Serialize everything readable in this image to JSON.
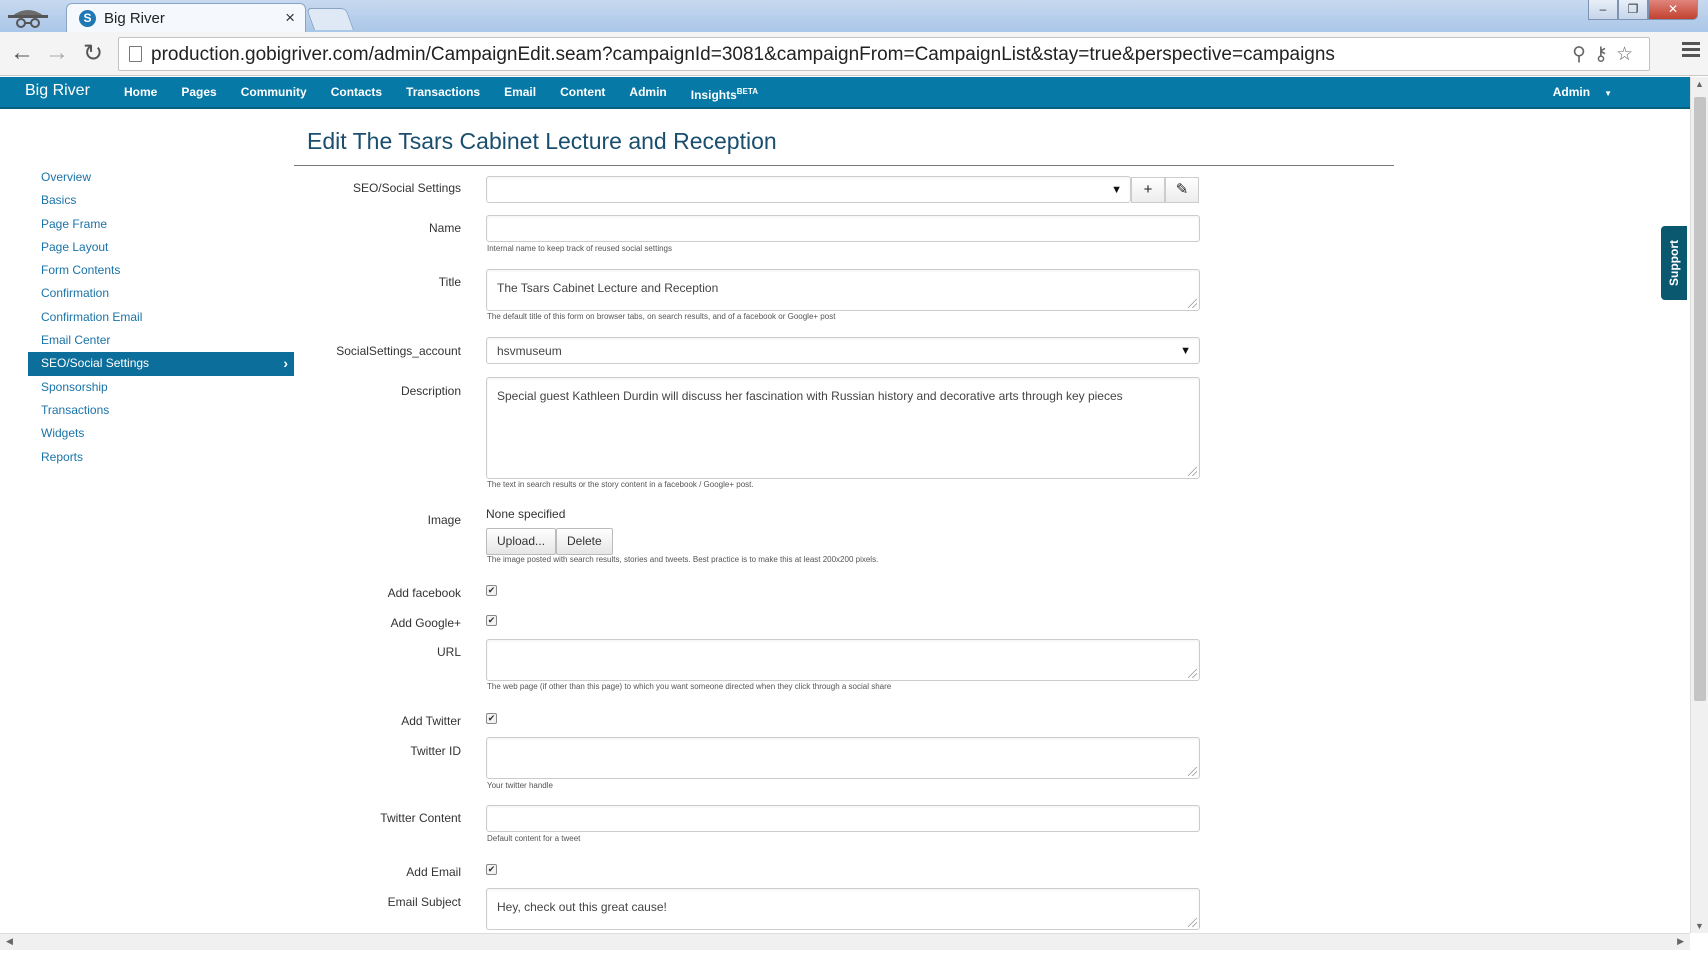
{
  "browser": {
    "tab_title": "Big River",
    "tab_close": "×",
    "url": "production.gobigriver.com/admin/CampaignEdit.seam?campaignId=3081&campaignFrom=CampaignList&stay=true&perspective=campaigns",
    "window_controls": {
      "minimize": "–",
      "maximize": "❐",
      "close": "✕"
    }
  },
  "appbar": {
    "brand": "Big River",
    "nav": [
      "Home",
      "Pages",
      "Community",
      "Contacts",
      "Transactions",
      "Email",
      "Content",
      "Admin"
    ],
    "insights": "Insights",
    "insights_sup": "BETA",
    "user_menu": "Admin"
  },
  "sidebar": {
    "items": [
      "Overview",
      "Basics",
      "Page Frame",
      "Page Layout",
      "Form Contents",
      "Confirmation",
      "Confirmation Email",
      "Email Center",
      "SEO/Social Settings",
      "Sponsorship",
      "Transactions",
      "Widgets",
      "Reports"
    ],
    "active": "SEO/Social Settings"
  },
  "page": {
    "title": "Edit The Tsars Cabinet Lecture and Reception"
  },
  "form": {
    "seo_settings": {
      "label": "SEO/Social Settings",
      "value": ""
    },
    "name": {
      "label": "Name",
      "value": "",
      "help": "Internal name to keep track of reused social settings"
    },
    "title": {
      "label": "Title",
      "value": "The Tsars Cabinet Lecture and Reception",
      "help": "The default title of this form on browser tabs, on search results, and of a facebook or Google+ post"
    },
    "account": {
      "label": "SocialSettings_account",
      "value": "hsvmuseum"
    },
    "description": {
      "label": "Description",
      "value": "Special guest Kathleen Durdin will discuss her fascination with Russian history and decorative arts through key pieces",
      "help": "The text in search results or the story content in a facebook / Google+ post."
    },
    "image": {
      "label": "Image",
      "status": "None specified",
      "upload": "Upload...",
      "delete": "Delete",
      "help": "The image posted with search results, stories and tweets. Best practice is to make this at least 200x200 pixels."
    },
    "add_facebook": {
      "label": "Add facebook",
      "checked": true
    },
    "add_google": {
      "label": "Add Google+",
      "checked": true
    },
    "url": {
      "label": "URL",
      "value": "",
      "help": "The web page (if other than this page) to which you want someone directed when they click through a social share"
    },
    "add_twitter": {
      "label": "Add Twitter",
      "checked": true
    },
    "twitter_id": {
      "label": "Twitter ID",
      "value": "",
      "help": "Your twitter handle"
    },
    "twitter_content": {
      "label": "Twitter Content",
      "value": "",
      "help": "Default content for a tweet"
    },
    "add_email": {
      "label": "Add Email",
      "checked": true
    },
    "email_subject": {
      "label": "Email Subject",
      "value": "Hey, check out this great cause!"
    }
  },
  "support_tab": "Support",
  "glyphs": {
    "check": "✔",
    "plus": "+",
    "pencil": "✎",
    "caret": "▼",
    "chevron": "›"
  }
}
